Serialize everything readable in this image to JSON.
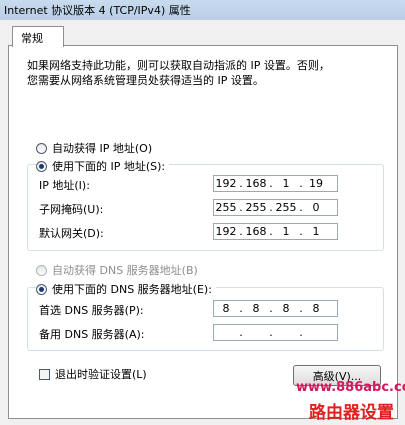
{
  "window": {
    "title": "Internet 协议版本 4 (TCP/IPv4) 属性"
  },
  "tab": {
    "label": "常规"
  },
  "description": {
    "line1": "如果网络支持此功能，则可以获取自动指派的 IP 设置。否则，",
    "line2": "您需要从网络系统管理员处获得适当的 IP 设置。"
  },
  "ip_section": {
    "auto_label": "自动获得 IP 地址(O)",
    "manual_label": "使用下面的 IP 地址(S):",
    "ip_label": "IP 地址(I):",
    "ip_value": [
      "192",
      "168",
      "1",
      "19"
    ],
    "mask_label": "子网掩码(U):",
    "mask_value": [
      "255",
      "255",
      "255",
      "0"
    ],
    "gateway_label": "默认网关(D):",
    "gateway_value": [
      "192",
      "168",
      "1",
      "1"
    ]
  },
  "dns_section": {
    "auto_label": "自动获得 DNS 服务器地址(B)",
    "manual_label": "使用下面的 DNS 服务器地址(E):",
    "preferred_label": "首选 DNS 服务器(P):",
    "preferred_value": [
      "8",
      "8",
      "8",
      "8"
    ],
    "alternate_label": "备用 DNS 服务器(A):",
    "alternate_value": [
      "",
      "",
      "",
      ""
    ]
  },
  "footer": {
    "validate_label": "退出时验证设置(L)",
    "advanced_button": "高级(V)..."
  },
  "watermark": {
    "url": "www.886abc.com",
    "name": "路由器设置"
  }
}
